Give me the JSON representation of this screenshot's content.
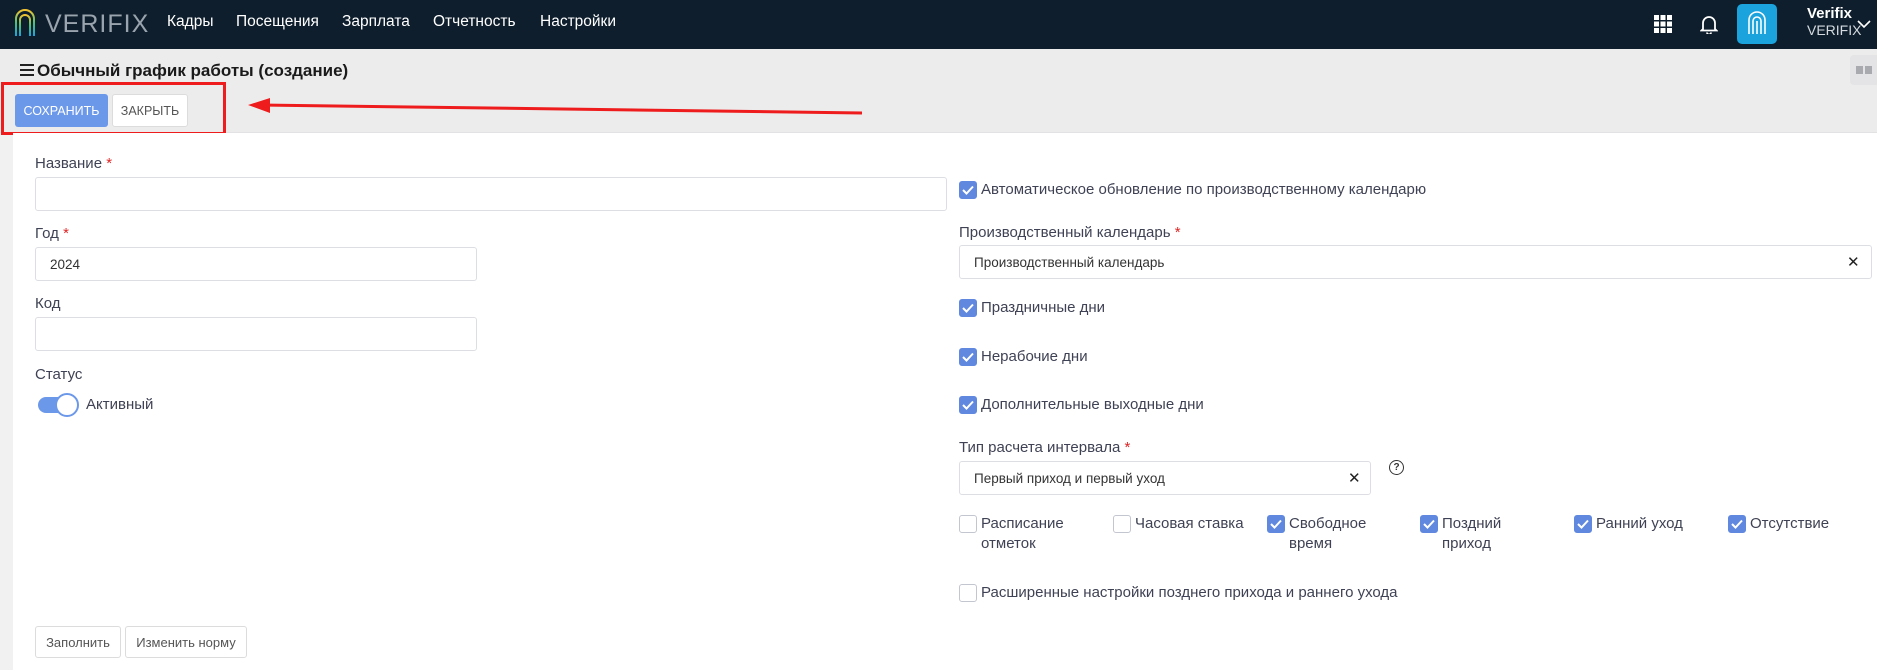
{
  "brand": {
    "logo_text": "VERIFIX"
  },
  "nav": {
    "items": [
      "Кадры",
      "Посещения",
      "Зарплата",
      "Отчетность",
      "Настройки"
    ]
  },
  "icons": {
    "apps": "grid-apps-icon",
    "notifications": "bell-icon",
    "avatar": "fingerprint-icon",
    "user_menu": "chevron-down-icon"
  },
  "user": {
    "name": "Verifix",
    "org": "VERIFIX"
  },
  "page": {
    "title": "Обычный график работы (создание)"
  },
  "toolbar": {
    "save_label": "СОХРАНИТЬ",
    "close_label": "ЗАКРЫТЬ"
  },
  "form": {
    "name": {
      "label": "Название",
      "value": ""
    },
    "year": {
      "label": "Год",
      "value": "2024"
    },
    "code": {
      "label": "Код",
      "value": ""
    },
    "status": {
      "label": "Статус",
      "toggle_label": "Активный",
      "active": true
    },
    "required_mark": "*"
  },
  "right": {
    "auto_update": {
      "label": "Автоматическое обновление по производственному календарю",
      "checked": true
    },
    "calendar": {
      "label": "Производственный календарь",
      "value": "Производственный календарь"
    },
    "holidays": {
      "label": "Праздничные дни",
      "checked": true
    },
    "nonworking": {
      "label": "Нерабочие дни",
      "checked": true
    },
    "extra_days_off": {
      "label": "Дополнительные выходные дни",
      "checked": true
    },
    "interval_type": {
      "label": "Тип расчета интервала",
      "value": "Первый приход и первый уход",
      "help": "?"
    },
    "options": [
      {
        "line1": "Расписание",
        "line2": "отметок",
        "checked": false
      },
      {
        "line1": "Часовая ставка",
        "line2": "",
        "checked": false
      },
      {
        "line1": "Свободное",
        "line2": "время",
        "checked": true
      },
      {
        "line1": "Поздний",
        "line2": "приход",
        "checked": true
      },
      {
        "line1": "Ранний уход",
        "line2": "",
        "checked": true
      },
      {
        "line1": "Отсутствие",
        "line2": "",
        "checked": true
      }
    ],
    "advanced": {
      "label": "Расширенные настройки позднего прихода и раннего ухода",
      "checked": false
    }
  },
  "bottom": {
    "fill_label": "Заполнить",
    "change_norm_label": "Изменить норму"
  },
  "colors": {
    "navbar": "#0e1e2c",
    "primary": "#6c98ea",
    "checkbox": "#5f88de",
    "annotation": "#ee1c1c"
  }
}
